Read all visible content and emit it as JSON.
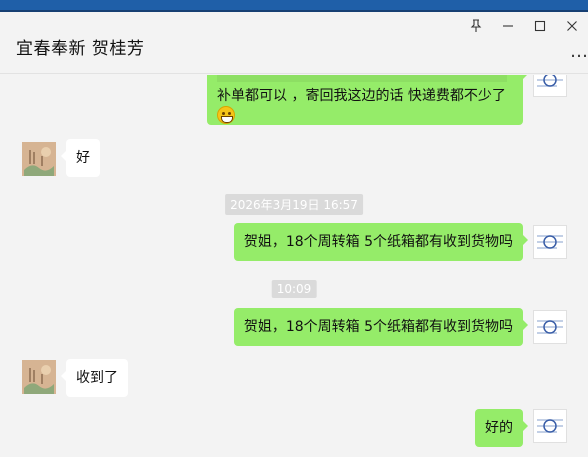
{
  "window": {
    "pin_icon": "pin-icon",
    "minimize_icon": "minimize-icon",
    "maximize_icon": "maximize-icon",
    "close_icon": "close-icon",
    "more_icon": "more-icon"
  },
  "chat": {
    "title": "宜春奉新 贺桂芳",
    "messages": [
      {
        "sender": "self",
        "text_line1": "补单都可以 ，寄回我这边的话 快递费都不少了",
        "emoji": "grin-emoji"
      },
      {
        "sender": "contact",
        "text": "好"
      },
      {
        "type": "timestamp",
        "text": "2026年3月19日 16:57"
      },
      {
        "sender": "self",
        "text": "贺姐，18个周转箱  5个纸箱都有收到货物吗"
      },
      {
        "type": "timestamp",
        "text": "10:09"
      },
      {
        "sender": "self",
        "text": "贺姐，18个周转箱  5个纸箱都有收到货物吗"
      },
      {
        "sender": "contact",
        "text": "收到了"
      },
      {
        "sender": "self",
        "text": "好的"
      }
    ]
  },
  "colors": {
    "outgoing_bubble": "#95ec69",
    "incoming_bubble": "#ffffff",
    "background": "#f3f3f3",
    "accent_bar": "#1f5fa8"
  }
}
